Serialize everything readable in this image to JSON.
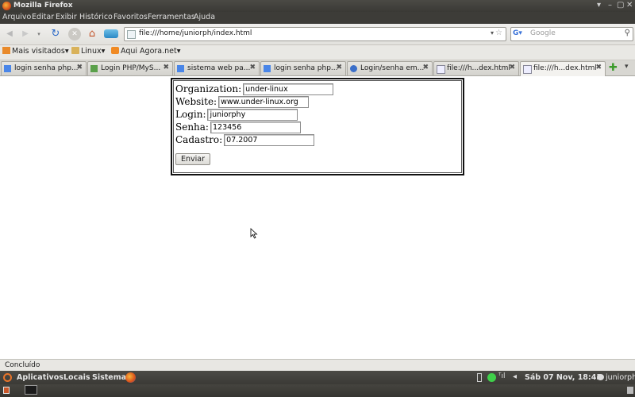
{
  "window": {
    "title": "Mozilla Firefox",
    "controls": [
      "▾",
      "–",
      "▢",
      "✕"
    ]
  },
  "menu": [
    "Arquivo",
    "Editar",
    "Exibir",
    "Histórico",
    "Favoritos",
    "Ferramentas",
    "Ajuda"
  ],
  "nav": {
    "url": "file:///home/juniorph/index.html",
    "search_placeholder": "Google"
  },
  "bookmarks": [
    {
      "label": "Mais visitados▾",
      "icon": "most-visited-icon"
    },
    {
      "label": "Linux▾",
      "icon": "folder-icon"
    },
    {
      "label": "Aqui Agora.net▾",
      "icon": "rss-icon"
    }
  ],
  "tabs": [
    {
      "label": "login senha php...",
      "icon": "google-favicon"
    },
    {
      "label": "Login PHP/MyS...",
      "icon": "site-favicon"
    },
    {
      "label": "sistema web pa...",
      "icon": "google-favicon"
    },
    {
      "label": "login senha php...",
      "icon": "google-favicon"
    },
    {
      "label": "Login/senha em...",
      "icon": "site-favicon"
    },
    {
      "label": "file:///h...dex.html",
      "icon": "file-favicon"
    },
    {
      "label": "file:///h...dex.html",
      "icon": "file-favicon",
      "active": true
    }
  ],
  "form": {
    "org_label": "Organization:",
    "org_value": "under-linux",
    "web_label": "Website:",
    "web_value": "www.under-linux.org",
    "login_label": "Login:",
    "login_value": "juniorphy",
    "senha_label": "Senha:",
    "senha_value": "123456",
    "cadastro_label": "Cadastro:",
    "cadastro_value": "07.2007",
    "submit_label": "Enviar"
  },
  "status": "Concluído",
  "panel": {
    "menus": [
      "Aplicativos",
      "Locais",
      "Sistema"
    ],
    "clock": "Sáb 07 Nov, 18:43",
    "user": "juniorph"
  }
}
